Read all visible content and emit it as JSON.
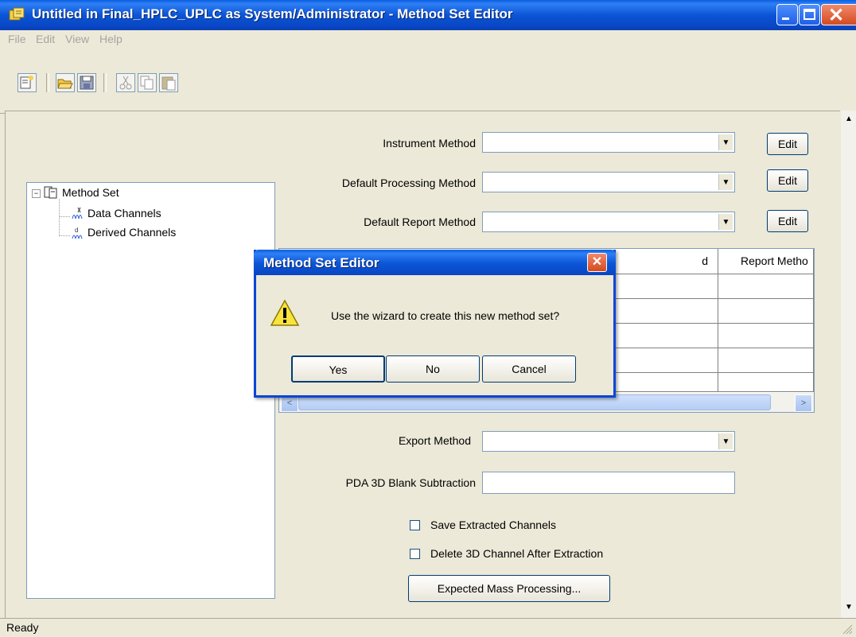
{
  "window": {
    "title": "Untitled in Final_HPLC_UPLC as System/Administrator - Method Set Editor"
  },
  "menu": [
    "File",
    "Edit",
    "View",
    "Help"
  ],
  "toolbar": {
    "icons": [
      "new-method-set-icon",
      "open-folder-icon",
      "save-icon",
      "cut-icon",
      "copy-icon",
      "paste-icon"
    ]
  },
  "tree": {
    "root": "Method Set",
    "children": [
      "Data Channels",
      "Derived Channels"
    ]
  },
  "form": {
    "instrument_method_label": "Instrument Method",
    "default_processing_label": "Default Processing Method",
    "default_report_label": "Default Report Method",
    "edit_label": "Edit",
    "export_method_label": "Export Method",
    "pda_label": "PDA 3D Blank Subtraction",
    "save_extracted_label": "Save Extracted Channels",
    "delete_3d_label": "Delete 3D Channel After Extraction",
    "expected_mass_label": "Expected Mass Processing..."
  },
  "grid": {
    "partial_header": "d",
    "report_header": "Report Metho"
  },
  "dialog": {
    "title": "Method Set Editor",
    "message": "Use the wizard to create this new method set?",
    "yes": "Yes",
    "no": "No",
    "cancel": "Cancel"
  },
  "status": {
    "text": "Ready"
  }
}
